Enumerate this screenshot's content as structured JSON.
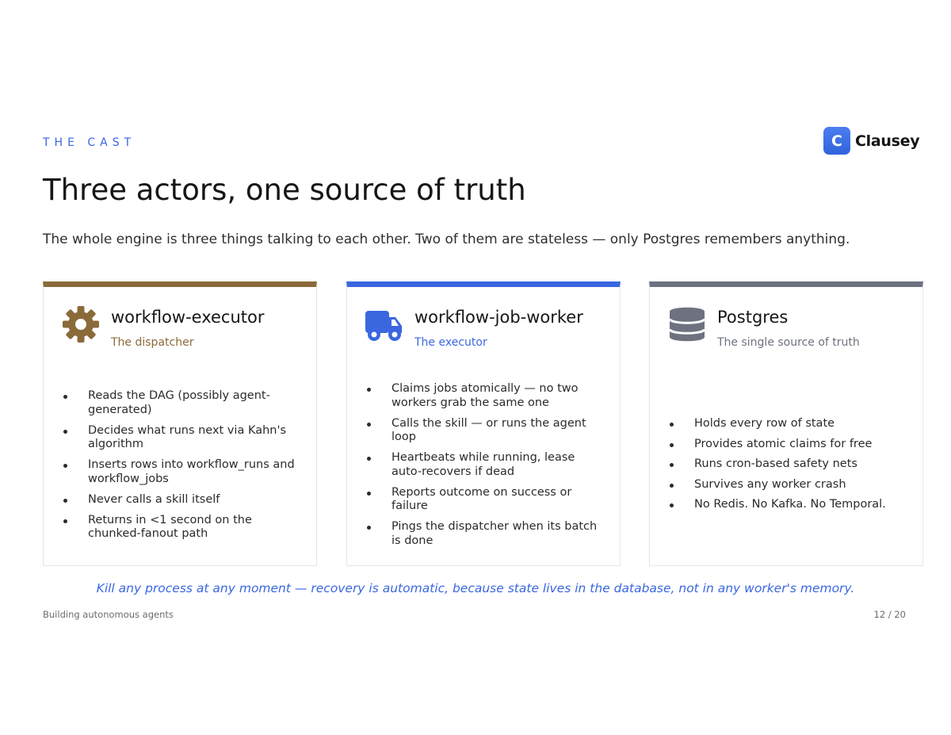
{
  "header": {
    "eyebrow": "THE CAST",
    "title": "Three actors, one source of truth",
    "subtitle": "The whole engine is three things talking to each other. Two of them are stateless — only Postgres remembers anything."
  },
  "brand": {
    "mark": "C",
    "name": "Clausey",
    "color": "#3a67e0"
  },
  "cards": [
    {
      "name": "workflow-executor",
      "role": "The dispatcher",
      "icon": "gear-icon",
      "accent": "#8b6a3a",
      "items": [
        "Reads the DAG (possibly agent-generated)",
        "Decides what runs next via Kahn's algorithm",
        "Inserts rows into workflow_runs and workflow_jobs",
        "Never calls a skill itself",
        "Returns in <1 second on the chunked-fanout path"
      ]
    },
    {
      "name": "workflow-job-worker",
      "role": "The executor",
      "icon": "truck-icon",
      "accent": "#3a67e0",
      "items": [
        "Claims jobs atomically — no two workers grab the same one",
        "Calls the skill — or runs the agent loop",
        "Heartbeats while running, lease auto-recovers if dead",
        "Reports outcome on success or failure",
        "Pings the dispatcher when its batch is done"
      ]
    },
    {
      "name": "Postgres",
      "role": "The single source of truth",
      "icon": "database-icon",
      "accent": "#6e7280",
      "items": [
        "Holds every row of state",
        "Provides atomic claims for free",
        "Runs cron-based safety nets",
        "Survives any worker crash",
        "No Redis. No Kafka. No Temporal."
      ]
    }
  ],
  "tagline": "Kill any process at any moment — recovery is automatic, because state lives in the database, not in any worker's memory.",
  "footer": {
    "deck_title": "Building autonomous agents",
    "page": "12 / 20"
  }
}
